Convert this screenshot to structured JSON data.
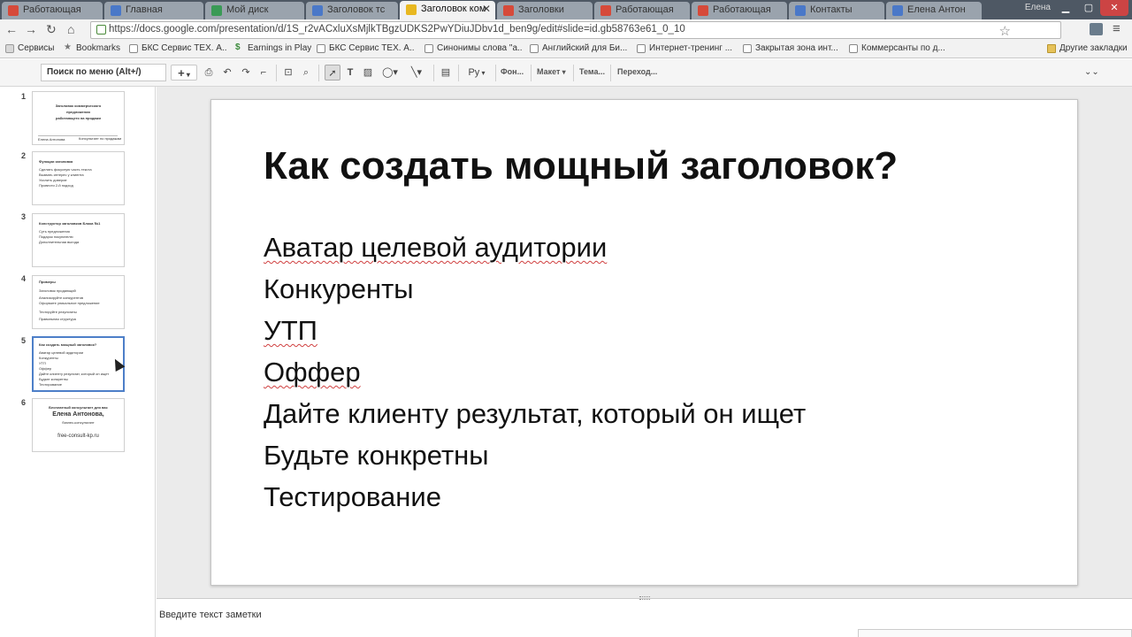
{
  "browser": {
    "tabs": [
      {
        "label": "Работающая",
        "icon_color": "#d64a3a",
        "active": false
      },
      {
        "label": "Главная",
        "icon_color": "#4a78c8",
        "active": false
      },
      {
        "label": "Мой диск",
        "icon_color": "#3a9a56",
        "active": false
      },
      {
        "label": "Заголовок тс",
        "icon_color": "#4a78c8",
        "active": false
      },
      {
        "label": "Заголовок ком",
        "icon_color": "#e8b820",
        "active": true
      },
      {
        "label": "Заголовки",
        "icon_color": "#d64a3a",
        "active": false
      },
      {
        "label": "Работающая",
        "icon_color": "#d64a3a",
        "active": false
      },
      {
        "label": "Работающая",
        "icon_color": "#d64a3a",
        "active": false
      },
      {
        "label": "Контакты",
        "icon_color": "#4a78c8",
        "active": false
      },
      {
        "label": "Елена Антон",
        "icon_color": "#4a78c8",
        "active": false
      }
    ],
    "user_badge": "Елена",
    "url": "https://docs.google.com/presentation/d/1S_r2vACxluXsMjlkTBgzUDKS2PwYDiuJDbv1d_ben9g/edit#slide=id.gb58763e61_0_10",
    "bookmarks": [
      {
        "label": "Сервисы",
        "folder": false
      },
      {
        "label": "Bookmarks",
        "folder": false
      },
      {
        "label": "БКС Сервис ТЕХ. А...",
        "folder": false
      },
      {
        "label": "Earnings in Play",
        "folder": false
      },
      {
        "label": "БКС Сервис ТЕХ. А...",
        "folder": false
      },
      {
        "label": "Синонимы слова \"a...",
        "folder": false
      },
      {
        "label": "Английский для Би...",
        "folder": false
      },
      {
        "label": "Интернет-тренинг ...",
        "folder": false
      },
      {
        "label": "Закрытая зона инт...",
        "folder": false
      },
      {
        "label": "Коммерсанты по д...",
        "folder": false
      },
      {
        "label": "Другие закладки",
        "folder": true
      }
    ]
  },
  "toolbar": {
    "menu_search_placeholder": "Поиск по меню (Alt+/)",
    "add_label": "+",
    "language_label": "Ру",
    "background_label": "Фон...",
    "layout_label": "Макет",
    "theme_label": "Тема...",
    "transition_label": "Переход..."
  },
  "filmstrip": {
    "slides": [
      {
        "number": "1",
        "lines": [
          "Заголовок коммерческого",
          "предложения",
          "работающего на продажи",
          "Елена Антонова",
          "Консультант по продажам"
        ]
      },
      {
        "number": "2",
        "lines": [
          "Функции заголовка",
          "Сделать фокусную часть текста",
          "Вызвать интерес у клиента",
          "Усилить доверие",
          "Провести 2-й подход"
        ]
      },
      {
        "number": "3",
        "lines": [
          "Конструктор заголовков Блока №1",
          "Суть предложения",
          "Подарок покупателю",
          "Дополнительная выгода"
        ]
      },
      {
        "number": "4",
        "lines": [
          "Примеры",
          "Заголовок продающий",
          "Анализируйте конкурентов",
          "Оформите уникальное предложение",
          "Тестируйте результаты",
          "Правильная структура"
        ]
      },
      {
        "number": "5",
        "lines": [
          "Как создать мощный заголовок?",
          "Аватар целевой аудитории",
          "Конкуренты",
          "УТП",
          "Оффер",
          "Дайте клиенту результат, который он ищет",
          "Будьте конкретны",
          "Тестирование"
        ]
      },
      {
        "number": "6",
        "lines": [
          "Бесплатный консультант для вас",
          "Елена Антонова,",
          "бизнес-консультант",
          "free-consult-kp.ru"
        ]
      }
    ],
    "selected_index": 4
  },
  "slide": {
    "title": "Как создать мощный заголовок?",
    "bullets": [
      "Аватар целевой аудитории",
      "Конкуренты",
      "УТП",
      "Оффер",
      "Дайте клиенту результат, который он ищет",
      "Будьте конкретны",
      "Тестирование"
    ]
  },
  "notes": {
    "placeholder": "Введите текст заметки"
  }
}
